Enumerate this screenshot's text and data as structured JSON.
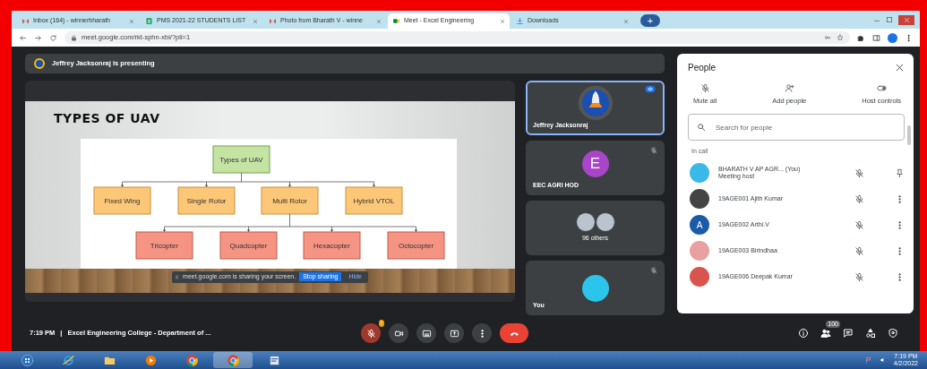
{
  "browser": {
    "tabs": [
      {
        "title": "Inbox (164) - winnerbharath",
        "kind": "mail",
        "selected": false
      },
      {
        "title": "PMS 2021-22 STUDENTS LIST",
        "kind": "sheet",
        "selected": false
      },
      {
        "title": "Photo from Bharath V - winne",
        "kind": "mail",
        "selected": false
      },
      {
        "title": "Meet - Excel Engineering",
        "kind": "meet",
        "selected": true
      },
      {
        "title": "Downloads",
        "kind": "download",
        "selected": false
      }
    ],
    "new_tab": "+",
    "address": "meet.google.com/rkt-sphn-xbi/?pli=1"
  },
  "meeting": {
    "presenting_banner": "Jeffrey Jacksonraj is presenting",
    "slide": {
      "title": "TYPES OF UAV",
      "diagram": {
        "label": "Types of UAV",
        "children": [
          {
            "label": "Fixed Wing"
          },
          {
            "label": "Single Rotor"
          },
          {
            "label": "Multi Rotor",
            "children": [
              {
                "label": "Tricopter"
              },
              {
                "label": "Quadcopter"
              },
              {
                "label": "Hexacopter"
              },
              {
                "label": "Octocopter"
              }
            ]
          },
          {
            "label": "Hybrid VTOL"
          }
        ]
      }
    },
    "share_notice": {
      "text": "meet.google.com is sharing your screen.",
      "buttons": [
        {
          "label": "Stop sharing",
          "kind": "primary"
        },
        {
          "label": "Hide",
          "kind": "link"
        }
      ]
    },
    "tiles": [
      {
        "name": "Jeffrey Jacksonraj",
        "kind": "rocket",
        "selected": true,
        "speaking": true,
        "muted": false
      },
      {
        "name": "EEC AGRI HOD",
        "kind": "letter",
        "letter": "E",
        "color": "#a845c8",
        "selected": false,
        "speaking": false,
        "muted": true
      },
      {
        "name": "96 others",
        "kind": "group",
        "selected": false,
        "speaking": false,
        "muted": false
      },
      {
        "name": "You",
        "kind": "photo",
        "selected": false,
        "speaking": false,
        "muted": true
      }
    ]
  },
  "people_panel": {
    "title": "People",
    "actions": [
      {
        "label": "Mute all",
        "kind": "mute"
      },
      {
        "label": "Add people",
        "kind": "add"
      },
      {
        "label": "Host controls",
        "kind": "host"
      }
    ],
    "search": {
      "placeholder": "Search for people"
    },
    "section": "In call",
    "participants": [
      {
        "name": "BHARATH V AP AGR... (You)",
        "subtitle": "Meeting host",
        "kind": "photo",
        "self": true
      },
      {
        "name": "19AGE001 Ajith Kumar",
        "kind": "photo",
        "self": false
      },
      {
        "name": "19AGE002 Arthi.V",
        "kind": "letter",
        "letter": "A",
        "color": "#1b5aa8",
        "self": false
      },
      {
        "name": "19AGE003 Birindhaa",
        "kind": "photo",
        "self": false
      },
      {
        "name": "19AGE006 Deepak Kumar",
        "kind": "photo",
        "self": false
      }
    ]
  },
  "bottom_bar": {
    "time": "7:19 PM",
    "separator": "|",
    "meeting_title": "Excel Engineering College - Department of ...",
    "controls": [
      {
        "kind": "mic",
        "on": false,
        "badge": "!"
      },
      {
        "kind": "camera",
        "on": true
      },
      {
        "kind": "captions",
        "on": true
      },
      {
        "kind": "present",
        "on": true
      },
      {
        "kind": "more",
        "on": true
      },
      {
        "kind": "end-call",
        "on": true
      }
    ],
    "side_controls": [
      {
        "kind": "info"
      },
      {
        "kind": "people",
        "badge": "100"
      },
      {
        "kind": "chat"
      },
      {
        "kind": "activities"
      },
      {
        "kind": "host-controls"
      }
    ]
  },
  "taskbar": {
    "apps": [
      {
        "kind": "start",
        "selected": false
      },
      {
        "kind": "ie",
        "selected": false
      },
      {
        "kind": "folder",
        "selected": false
      },
      {
        "kind": "media",
        "selected": false
      },
      {
        "kind": "chrome",
        "selected": false
      },
      {
        "kind": "chrome",
        "selected": true
      },
      {
        "kind": "app",
        "selected": false
      }
    ],
    "time": "7:19 PM",
    "date": "4/2/2022"
  }
}
